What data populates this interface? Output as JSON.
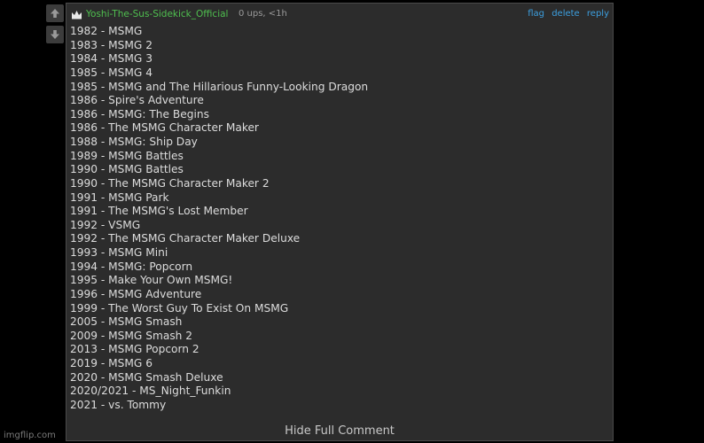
{
  "vote": {
    "upvote_icon": "arrow-up-icon",
    "downvote_icon": "arrow-down-icon"
  },
  "comment": {
    "avatar_icon": "crown-icon",
    "username": "Yoshi-The-Sus-Sidekick_Official",
    "meta": "0 ups, <1h",
    "actions": {
      "flag": "flag",
      "delete": "delete",
      "reply": "reply"
    },
    "lines": [
      "1982 - MSMG",
      "1983 - MSMG 2",
      "1984 - MSMG 3",
      "1985 - MSMG 4",
      "1985 - MSMG and The Hillarious Funny-Looking Dragon",
      "1986 - Spire's Adventure",
      "1986 - MSMG: The Begins",
      "1986 - The MSMG Character Maker",
      "1988 - MSMG: Ship Day",
      "1989 - MSMG Battles",
      "1990 - MSMG Battles",
      "1990 - The MSMG Character Maker 2",
      "1991 - MSMG Park",
      "1991 - The MSMG's Lost Member",
      "1992 - VSMG",
      "1992 - The MSMG Character Maker Deluxe",
      "1993 - MSMG Mini",
      "1994 - MSMG: Popcorn",
      "1995 - Make Your Own MSMG!",
      "1996 - MSMG Adventure",
      "1999 - The Worst Guy To Exist On MSMG",
      "2005 - MSMG Smash",
      "2009 - MSMG Smash 2",
      "2013 - MSMG Popcorn 2",
      "2019 - MSMG 6",
      "2020 - MSMG Smash Deluxe",
      "2020/2021 - MS_Night_Funkin",
      "2021 - vs. Tommy"
    ],
    "hide_full": "Hide Full Comment"
  },
  "watermark": "imgflip.com",
  "colors": {
    "background": "#000000",
    "panel": "#2c2c2c",
    "username": "#4fbf4f",
    "action_links": "#3c9fe0",
    "text": "#dcdcdc"
  }
}
